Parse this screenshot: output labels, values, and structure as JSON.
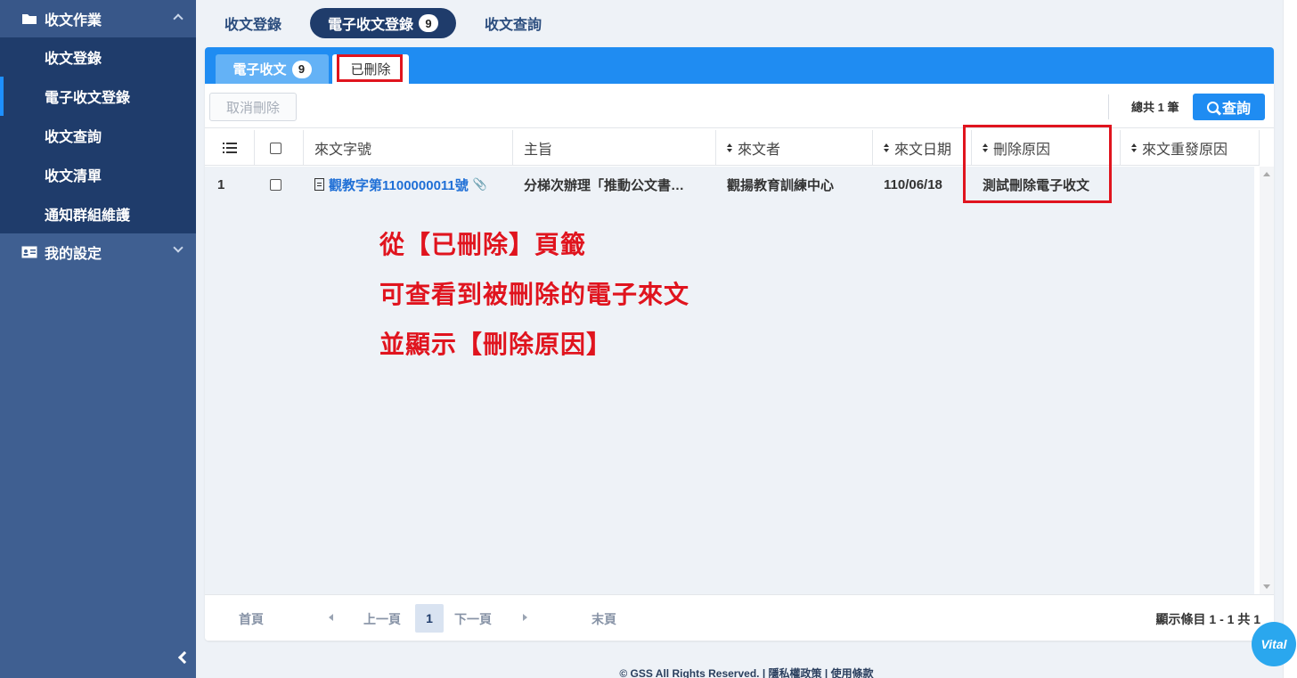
{
  "sidebar": {
    "group1": "收文作業",
    "items": [
      "收文登錄",
      "電子收文登錄",
      "收文查詢",
      "收文清單",
      "通知群組維護"
    ],
    "group2": "我的設定"
  },
  "top_tabs": {
    "tab1": "收文登錄",
    "tab2": "電子收文登錄",
    "tab2_badge": "9",
    "tab3": "收文查詢"
  },
  "panel_tabs": {
    "tab1": "電子收文",
    "tab1_badge": "9",
    "tab2": "已刪除"
  },
  "toolbar": {
    "cancel_delete": "取消刪除",
    "total": "總共 1 筆",
    "query": "查詢"
  },
  "table": {
    "headers": [
      "來文字號",
      "主旨",
      "來文者",
      "來文日期",
      "刪除原因",
      "來文重發原因"
    ],
    "rows": [
      {
        "index": "1",
        "doc_no": "觀教字第1100000011號",
        "subject": "分梯次辦理「推動公文書…",
        "sender": "觀揚教育訓練中心",
        "date": "110/06/18",
        "reason": "測試刪除電子收文",
        "resend_reason": ""
      }
    ]
  },
  "annotation": {
    "line1": "從【已刪除】頁籤",
    "line2": "可查看到被刪除的電子來文",
    "line3": "並顯示【刪除原因】"
  },
  "pager": {
    "first": "首頁",
    "prev": "上一頁",
    "current": "1",
    "next": "下一頁",
    "last": "末頁",
    "info": "顯示條目 1 - 1 共 1"
  },
  "footer": {
    "copyright": "© GSS All Rights Reserved.",
    "privacy": "隱私權政策",
    "terms": "使用條款"
  },
  "fab": {
    "label": "Vital"
  },
  "colors": {
    "accent": "#1f8cf2",
    "sidebar": "#3f5f91",
    "sidebar_dark": "#1f3c6b",
    "highlight": "#e0141e"
  }
}
